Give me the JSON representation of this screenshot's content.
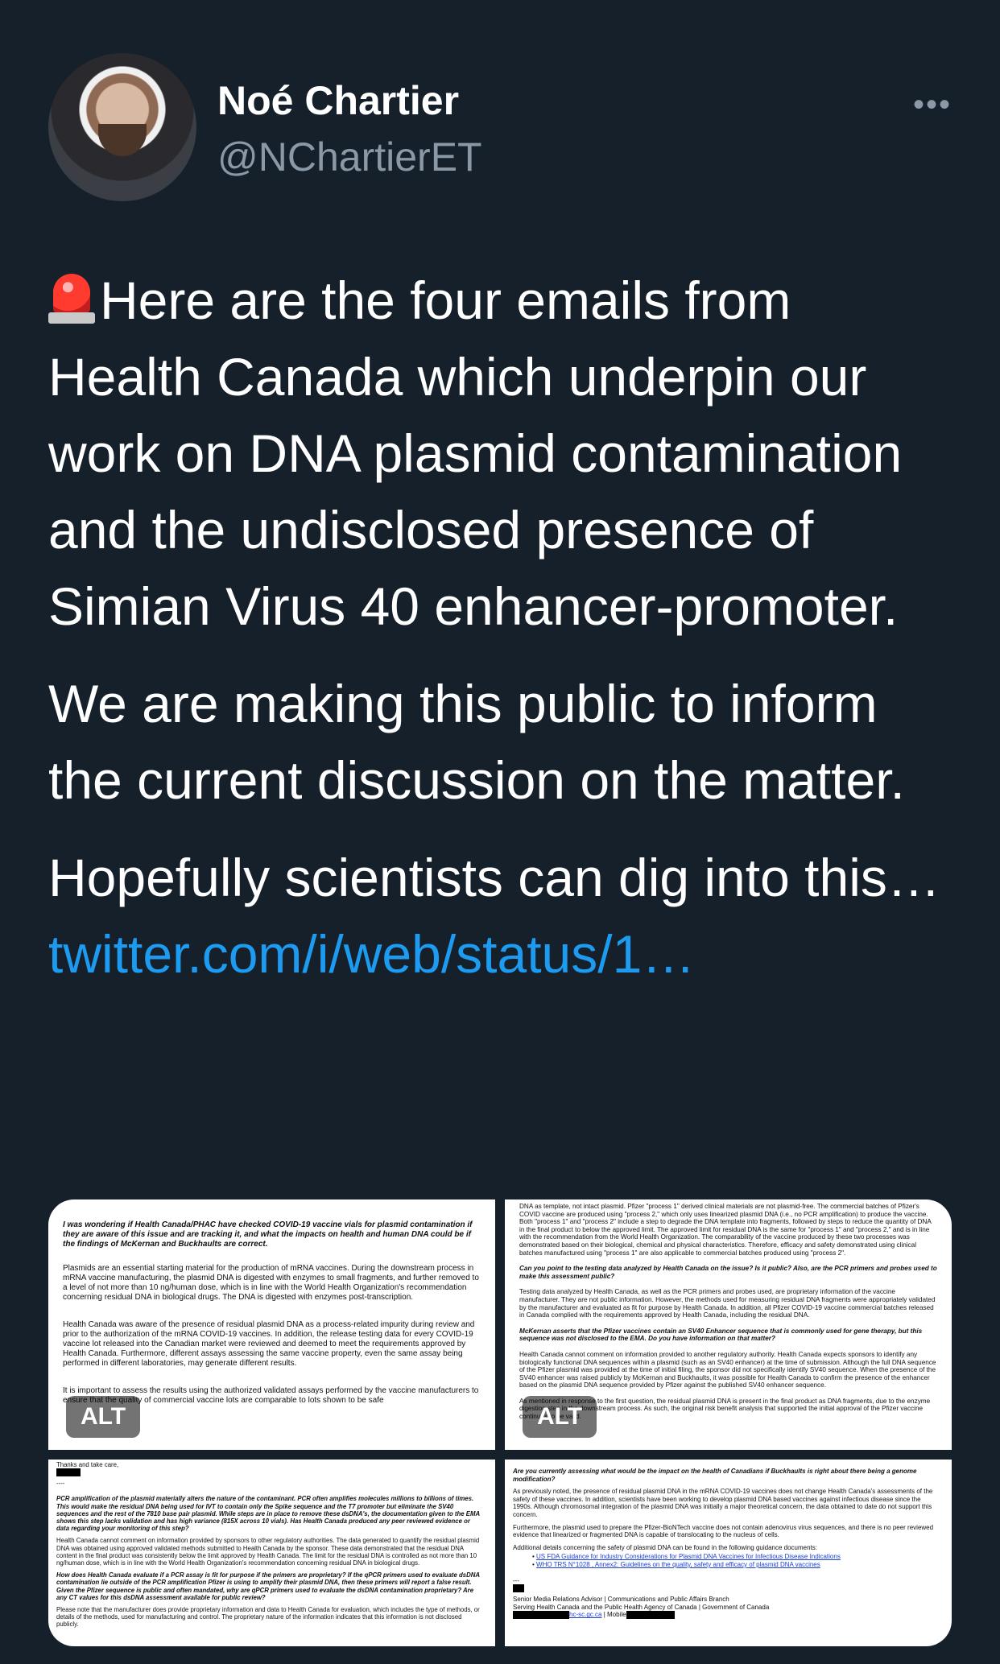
{
  "author": {
    "name": "Noé Chartier",
    "handle": "@NChartierET",
    "more_label": "•••"
  },
  "tweet": {
    "paragraph_1": "Here are the four emails from Health Canada which underpin our work on DNA plasmid contamination and the undisclosed presence of Simian Virus 40 enhancer-promoter.",
    "paragraph_2": "We are making this public to inform the current discussion on the matter.",
    "paragraph_3_text": "Hopefully scientists can dig into this… ",
    "paragraph_3_link": "twitter.com/i/web/status/1…"
  },
  "media": {
    "alt_badge": "ALT",
    "image_1": {
      "question": "I was wondering if Health Canada/PHAC have checked COVID-19 vaccine vials for plasmid contamination if they are aware of this issue and are tracking it, and what the impacts on health and human DNA could be if the findings of McKernan and Buckhaults are correct.",
      "para_1": "Plasmids are an essential starting material for the production of mRNA vaccines. During the downstream process in mRNA vaccine manufacturing, the plasmid DNA is digested with enzymes to small fragments, and further removed to a level of not more than 10 ng/human dose, which is in line with the World Health Organization's recommendation concerning residual DNA in biological drugs. The DNA is digested with enzymes post-transcription.",
      "para_2": "Health Canada was aware of the presence of residual plasmid DNA as a process-related impurity during review and prior to the authorization of the mRNA COVID-19 vaccines. In addition, the release testing data for every COVID-19 vaccine lot released into the Canadian market were reviewed and deemed to meet the requirements approved by Health Canada. Furthermore, different assays assessing the same vaccine property, even the same assay being performed in different laboratories, may generate different results.",
      "para_3": "It is important to assess the results using the authorized validated assays performed by the vaccine manufacturers to ensure that the quality of commercial vaccine lots are comparable to lots shown to be safe"
    },
    "image_2": {
      "para_0": "DNA as template, not intact plasmid. Pfizer \"process 1\" derived clinical materials are not plasmid-free. The commercial batches of Pfizer's COVID vaccine are produced using \"process 2,\" which only uses linearized plasmid DNA (i.e., no PCR amplification) to produce the vaccine. Both \"process 1\" and \"process 2\" include a step to degrade the DNA template into fragments, followed by steps to reduce the quantity of DNA in the final product to below the approved limit. The approved limit for residual DNA is the same for \"process 1\" and \"process 2,\" and is in line with the recommendation from the World Health Organization. The comparability of the vaccine produced by these two processes was demonstrated based on their biological, chemical and physical characteristics. Therefore, efficacy and safety demonstrated using clinical batches manufactured using \"process 1\" are also applicable to commercial batches produced using \"process 2\".",
      "question_1": "Can you point to the testing data analyzed by Health Canada on the issue? Is it public? Also, are the PCR primers and probes used to make this assessment public?",
      "para_1": "Testing data analyzed by Health Canada, as well as the PCR primers and probes used, are proprietary information of the vaccine manufacturer. They are not public information. However, the methods used for measuring residual DNA fragments were appropriately validated by the manufacturer and evaluated as fit for purpose by Health Canada. In addition, all Pfizer COVID-19 vaccine commercial batches released in Canada complied with the requirements approved by Health Canada, including the residual DNA.",
      "question_2": "McKernan asserts that the Pfizer vaccines contain an SV40 Enhancer sequence that is commonly used for gene therapy, but this sequence was not disclosed to the EMA. Do you have information on that matter?",
      "para_2": "Health Canada cannot comment on information provided to another regulatory authority. Health Canada expects sponsors to identify any biologically functional DNA sequences within a plasmid (such as an SV40 enhancer) at the time of submission. Although the full DNA sequence of the Pfizer plasmid was provided at the time of initial filing, the sponsor did not specifically identify SV40 sequence. When the presence of the SV40 enhancer was raised publicly by McKernan and Buckhaults, it was possible for Health Canada to confirm the presence of the enhancer based on the plasmid DNA sequence provided by Pfizer against the published SV40 enhancer sequence.",
      "para_3": "As mentioned in response to the first question, the residual plasmid DNA is present in the final product as DNA fragments, due to the enzyme digestion step in the downstream process. As such, the original risk benefit analysis that supported the initial approval of the Pfizer vaccine continues to be valid."
    },
    "image_3": {
      "line_1": "Thanks and take care,",
      "line_2": "----",
      "question": "PCR amplification of the plasmid materially alters the nature of the contaminant. PCR often amplifies molecules millions to billions of times. This would make the residual DNA being used for IVT to contain only the Spike sequence and the T7 promoter but eliminate the SV40 sequences and the rest of the 7810 base pair plasmid. While steps are in place to remove these dsDNA's, the documentation given to the EMA shows this step lacks validation and has high variance (815X across 10 vials). Has Health Canada produced any peer reviewed evidence or data regarding your monitoring of this step?",
      "para_1": "Health Canada cannot comment on information provided by sponsors to other regulatory authorities. The data generated to quantify the residual plasmid DNA was obtained using approved validated methods submitted to Health Canada by the sponsor. These data demonstrated that the residual DNA content in the final product was consistently below the limit approved by Health Canada. The limit for the residual DNA is controlled as not more than 10 ng/human dose, which is in line with the World Health Organization's recommendation concerning residual DNA in biological drugs.",
      "question_2": "How does Health Canada evaluate if a PCR assay is fit for purpose if the primers are proprietary? If the qPCR primers used to evaluate dsDNA contamination lie outside of the PCR amplification Pfizer is using to amplify their plasmid DNA, then these primers will report a false result. Given the Pfizer sequence is public and often mandated, why are qPCR primers used to evaluate the dsDNA contamination proprietary? Are any CT values for this dsDNA assessment available for public review?",
      "para_2": "Please note that the manufacturer does provide proprietary information and data to Health Canada for evaluation, which includes the type of methods, or details of the methods, used for manufacturing and control. The proprietary nature of the information indicates that this information is not disclosed publicly."
    },
    "image_4": {
      "question": "Are you currently assessing what would be the impact on the health of Canadians if Buckhaults is right about there being a genome modification?",
      "para_1": "As previously noted, the presence of residual plasmid DNA in the mRNA COVID-19 vaccines does not change Health Canada's assessments of the safety of these vaccines. In addition, scientists have been working to develop plasmid DNA based vaccines against infectious disease since the 1990s. Although chromosomal integration of the plasmid DNA was initially a major theoretical concern, the data obtained to date do not support this concern.",
      "para_2": "Furthermore, the plasmid used to prepare the Pfizer-BioNTech vaccine does not contain adenovirus virus sequences, and there is no peer reviewed evidence that linearized or fragmented DNA is capable of translocating to the nucleus of cells.",
      "para_3": "Additional details concerning the safety of plasmid DNA can be found in the following guidance documents:",
      "link_1": "US FDA Guidance for Industry Considerations for Plasmid DNA Vaccines for Infectious Disease Indications",
      "link_2": "WHO TRS N°1028 , Annex2: Guidelines on the quality, safety and efficacy of plasmid DNA vaccines",
      "sig_sep": "---",
      "sig_1": "Senior Media Relations Advisor | Communications and Public Affairs Branch",
      "sig_2": "Serving Health Canada and the Public Health Agency of Canada | Government of Canada",
      "sig_3_email": "hc-sc.gc.ca",
      "sig_3_mobile": "| Mobile"
    }
  }
}
